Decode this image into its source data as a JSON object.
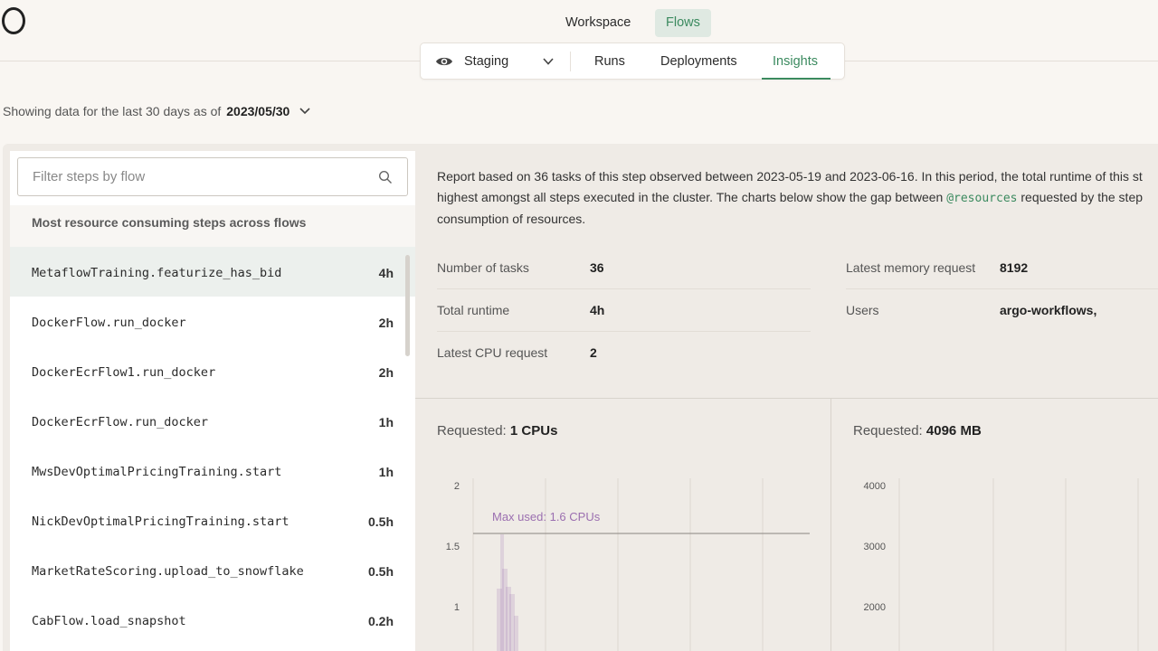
{
  "topnav": {
    "workspace": "Workspace",
    "flows": "Flows"
  },
  "subnav": {
    "environment": "Staging",
    "tabs": {
      "runs": "Runs",
      "deployments": "Deployments",
      "insights": "Insights"
    }
  },
  "date_filter": {
    "prefix": "Showing data for the last 30 days as of",
    "date": "2023/05/30"
  },
  "sidebar": {
    "search_placeholder": "Filter steps by flow",
    "heading": "Most resource consuming steps across flows",
    "steps": [
      {
        "name": "MetaflowTraining.featurize_has_bid",
        "duration": "4h"
      },
      {
        "name": "DockerFlow.run_docker",
        "duration": "2h"
      },
      {
        "name": "DockerEcrFlow1.run_docker",
        "duration": "2h"
      },
      {
        "name": "DockerEcrFlow.run_docker",
        "duration": "1h"
      },
      {
        "name": "MwsDevOptimalPricingTraining.start",
        "duration": "1h"
      },
      {
        "name": "NickDevOptimalPricingTraining.start",
        "duration": "0.5h"
      },
      {
        "name": "MarketRateScoring.upload_to_snowflake",
        "duration": "0.5h"
      },
      {
        "name": "CabFlow.load_snapshot",
        "duration": "0.2h"
      }
    ]
  },
  "report": {
    "line1": "Report based on 36 tasks of this step observed between 2023-05-19 and 2023-06-16. In this period, the total runtime of this st",
    "line2_pre": "highest amongst all steps executed in the cluster. The charts below show the gap between ",
    "line2_code": "@resources",
    "line2_post": " requested by the step",
    "line3": "consumption of resources."
  },
  "stats": {
    "number_of_tasks": {
      "label": "Number of tasks",
      "value": "36"
    },
    "total_runtime": {
      "label": "Total runtime",
      "value": "4h"
    },
    "latest_cpu": {
      "label": "Latest CPU request",
      "value": "2"
    },
    "latest_memory": {
      "label": "Latest memory request",
      "value": "8192"
    },
    "users": {
      "label": "Users",
      "value": "argo-workflows,"
    }
  },
  "cpu_chart": {
    "requested_label": "Requested:",
    "requested_value": "1 CPUs",
    "max_used_label": "Max used: 1.6 CPUs",
    "y_ticks": [
      "2",
      "1.5",
      "1"
    ]
  },
  "mem_chart": {
    "requested_label": "Requested:",
    "requested_value": "4096 MB",
    "y_ticks": [
      "4000",
      "3000",
      "2000"
    ]
  },
  "colors": {
    "accent": "#3b8a5f",
    "accent_bg": "#dfe9e2",
    "cpu_usage": "#9b6fb0"
  }
}
